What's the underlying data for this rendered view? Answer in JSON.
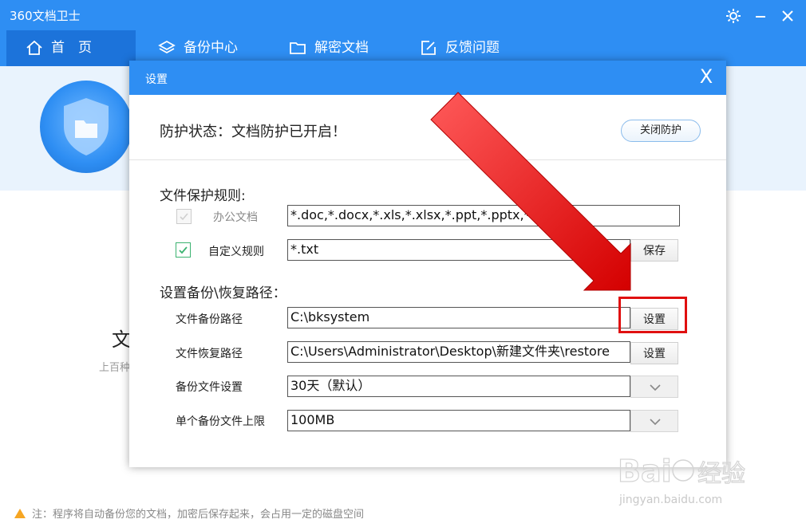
{
  "app": {
    "title": "360文档卫士"
  },
  "nav": {
    "items": [
      {
        "label": "首　页",
        "icon": "home-icon"
      },
      {
        "label": "备份中心",
        "icon": "layers-icon"
      },
      {
        "label": "解密文档",
        "icon": "folder-icon"
      },
      {
        "label": "反馈问题",
        "icon": "edit-icon"
      }
    ]
  },
  "background": {
    "title_fragment": "文",
    "subtitle_fragment": "上百种",
    "footer_note": "注：程序将自动备份您的文档，加密后保存起来，会占用一定的磁盘空间"
  },
  "dialog": {
    "title": "设置",
    "close": "X",
    "status_text": "防护状态：文档防护已开启！",
    "close_protection_label": "关闭防护",
    "rules": {
      "title": "文件保护规则:",
      "office_label": "办公文档",
      "office_value": "*.doc,*.docx,*.xls,*.xlsx,*.ppt,*.pptx,*.pdf",
      "office_checked": true,
      "custom_label": "自定义规则",
      "custom_value": "*.txt",
      "custom_checked": true,
      "save_label": "保存"
    },
    "paths": {
      "title": "设置备份\\恢复路径：",
      "backup_label": "文件备份路径",
      "backup_value": "C:\\bksystem",
      "backup_button": "设置",
      "restore_label": "文件恢复路径",
      "restore_value": "C:\\Users\\Administrator\\Desktop\\新建文件夹\\restore",
      "restore_button": "设置",
      "retention_label": "备份文件设置",
      "retention_value": "30天（默认）",
      "limit_label": "单个备份文件上限",
      "limit_value": "100MB"
    }
  },
  "colors": {
    "brand": "#2e8ef3",
    "highlight": "#e01010",
    "check": "#3cb371"
  },
  "watermark": {
    "logo": "Baidu经验",
    "url": "jingyan.baidu.com"
  }
}
